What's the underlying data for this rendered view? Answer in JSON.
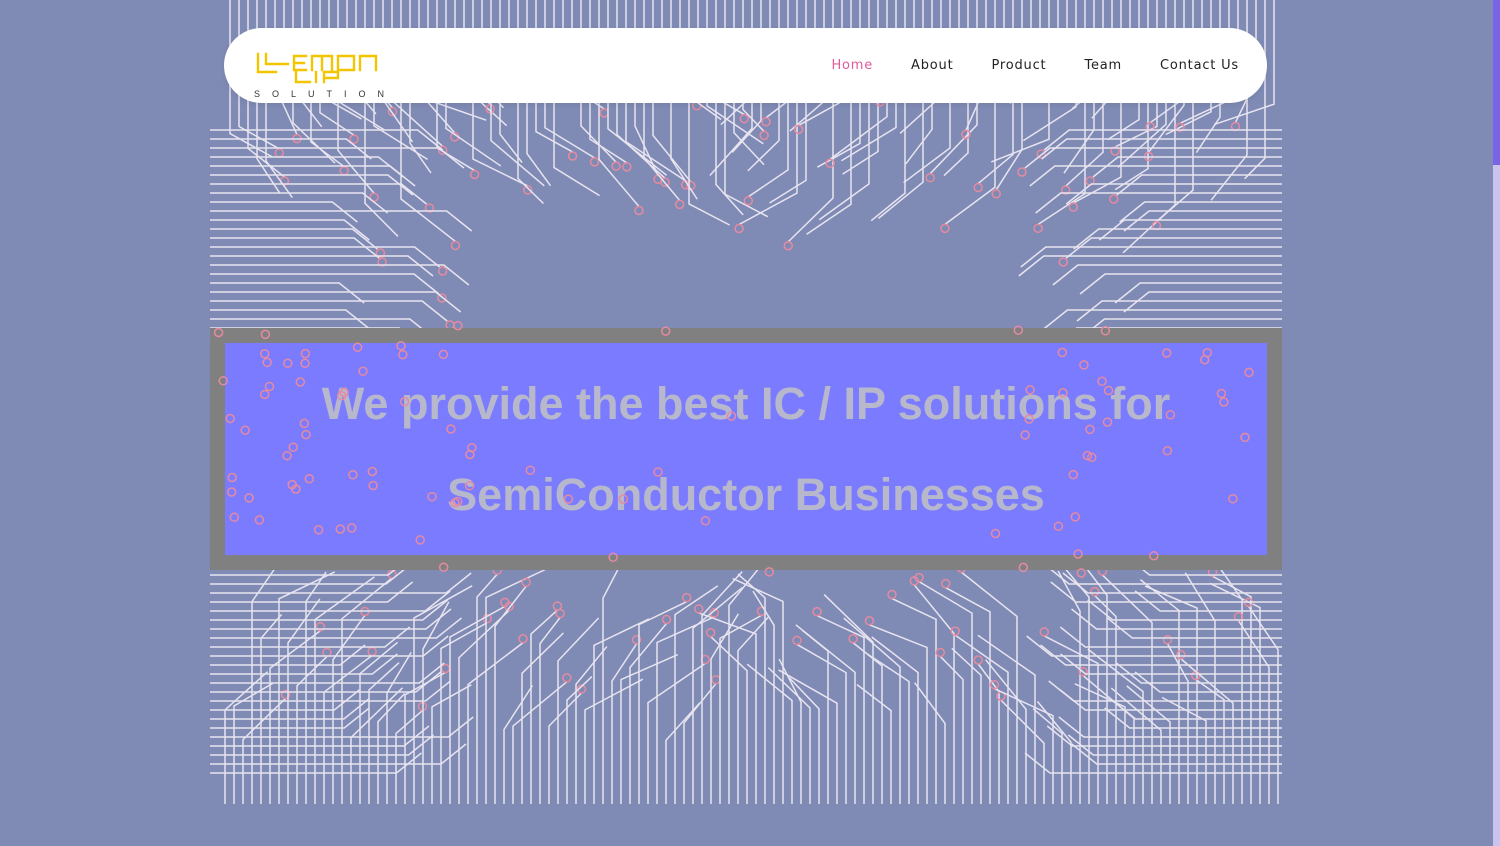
{
  "logo": {
    "line1": "LEMON",
    "line2": "LIP",
    "sub": "SOLUTION"
  },
  "nav": {
    "items": [
      {
        "label": "Home",
        "active": true
      },
      {
        "label": "About",
        "active": false
      },
      {
        "label": "Product",
        "active": false
      },
      {
        "label": "Team",
        "active": false
      },
      {
        "label": "Contact Us",
        "active": false
      }
    ]
  },
  "hero": {
    "headline_line1": "We provide the best IC / IP solutions for",
    "headline_line2": "SemiConductor Businesses"
  },
  "colors": {
    "page_bg": "#7f8bb5",
    "nav_active": "#e05c9b",
    "logo": "#f2c500",
    "banner_fill": "#7b7bff",
    "banner_border": "#808080",
    "headline": "#b8b8cc",
    "circuit_line": "#e8e4f0",
    "circuit_pad": "#e68aa0",
    "scrollbar_thumb": "#7a63e6"
  }
}
